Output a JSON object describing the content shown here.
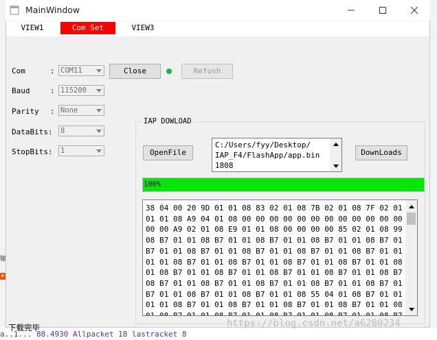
{
  "window": {
    "title": "MainWindow"
  },
  "tabs": [
    {
      "label": "VIEW1",
      "active": false
    },
    {
      "label": "Com Set",
      "active": true
    },
    {
      "label": "VIEW3",
      "active": false
    }
  ],
  "com_settings": {
    "com": {
      "label": "Com",
      "value": "COM11"
    },
    "baud": {
      "label": "Baud",
      "value": "115200"
    },
    "parity": {
      "label": "Parity",
      "value": "None"
    },
    "databits": {
      "label": "DataBits:",
      "value": "8"
    },
    "stopbits": {
      "label": "StopBits:",
      "value": "1"
    },
    "colon": ":",
    "close_button": "Close",
    "refresh_button": "Refush",
    "status_led_color": "#22b14c"
  },
  "iap": {
    "group_title": "IAP DOWLOAD",
    "openfile_button": "OpenFile",
    "path_lines": [
      "C:/Users/fyy/Desktop/",
      "IAP_F4/FlashApp/app.bin",
      "1808"
    ],
    "downloads_button": "DownLoads",
    "progress": {
      "value": 100,
      "text": "100%",
      "color": "#06e606"
    },
    "hex_lines": [
      "38 04 00 20 9D 01 01 08 83 02 01 08 7B 02 01 08 7F 02 01 08 E5",
      "01 01 08 A9 04 01 08 00 00 00 00 00 00 00 00 00 00 00 00 00 00",
      "00 00 A9 02 01 08 E9 01 01 08 00 00 00 00 85 02 01 08 99 03 01",
      "08 B7 01 01 08 B7 01 01 08 B7 01 01 08 B7 01 01 08 B7 01 01 08",
      "B7 01 01 08 B7 01 01 08 B7 01 01 08 B7 01 01 08 B7 01 01 08 B7",
      "01 01 08 B7 01 01 08 B7 01 01 08 B7 01 01 08 B7 01 01 08 B7 01",
      "01 08 B7 01 01 08 B7 01 01 08 B7 01 01 08 B7 01 01 08 B7 01 01",
      "08 B7 01 01 08 B7 01 01 08 B7 01 01 08 B7 01 01 08 B7 01 01 08",
      "B7 01 01 08 B7 01 01 08 B7 01 01 08 55 04 01 08 B7 01 01 08 B7",
      "01 01 08 B7 01 01 08 B7 01 01 08 B7 01 01 08 B7 01 01 08 B7 01",
      "01 08 B7 01 01 08 B7 01 01 08 B7 01 01 08 B7 01 01 08 B7 01 01",
      "08 B7 01 01 08 B7 01 01 08 B7 01 01 08 B7 01 01 08 B7 01 01 08"
    ]
  },
  "statusbar": {
    "text": "下载完毕"
  },
  "watermark": "https://blog.csdn.net/a6280234",
  "background_text": "a..1... 88.4930 Allpacket 18 lastracket 8"
}
